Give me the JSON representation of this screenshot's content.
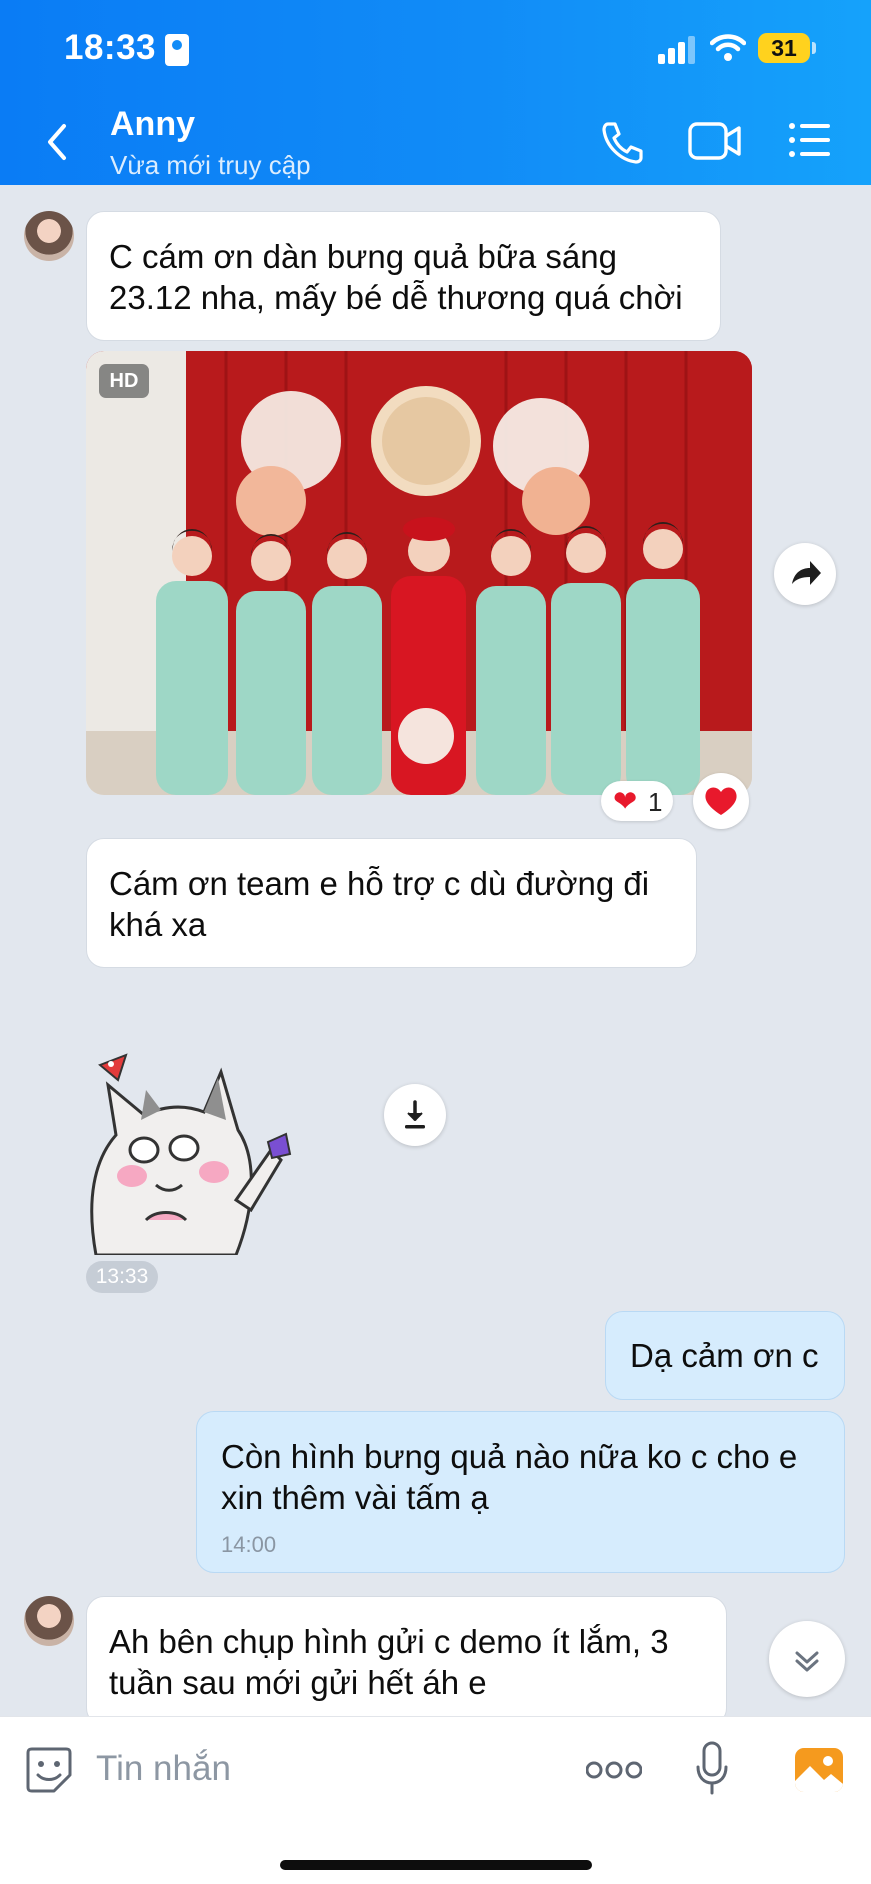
{
  "status_bar": {
    "time": "18:33",
    "battery": "31"
  },
  "header": {
    "contact_name": "Anny",
    "contact_status": "Vừa mới truy cập",
    "icons": [
      "back-chevron-icon",
      "phone-icon",
      "video-call-icon",
      "menu-list-icon"
    ]
  },
  "messages": [
    {
      "sender": "Anny",
      "direction": "in",
      "type": "text",
      "text": "C cám ơn dàn bưng quả bữa sáng 23.12 nha, mấy bé dễ thương quá chời"
    },
    {
      "sender": "Anny",
      "direction": "in",
      "type": "photo",
      "badge": "HD",
      "reaction": {
        "emoji": "❤",
        "count": "1"
      }
    },
    {
      "sender": "Anny",
      "direction": "in",
      "type": "text",
      "text": "Cám ơn team e hỗ trợ c dù đường đi khá xa"
    },
    {
      "sender": "Anny",
      "direction": "in",
      "type": "sticker",
      "time": "13:33"
    },
    {
      "sender": "me",
      "direction": "out",
      "type": "text",
      "text": "Dạ cảm ơn c"
    },
    {
      "sender": "me",
      "direction": "out",
      "type": "text",
      "text": "Còn hình bưng quả nào nữa ko c cho e xin thêm vài tấm ạ",
      "time": "14:00"
    },
    {
      "sender": "Anny",
      "direction": "in",
      "type": "text",
      "text": "Ah bên chụp hình gửi c demo ít lắm, 3 tuần sau mới gửi hết áh e"
    }
  ],
  "input": {
    "placeholder": "Tin nhắn"
  },
  "colors": {
    "header_gradient_start": "#0a7cf5",
    "header_gradient_end": "#15a2fb",
    "chat_bg": "#e2e7ee",
    "outgoing_bubble": "#d6ecfd",
    "reaction": "#e8192c"
  }
}
